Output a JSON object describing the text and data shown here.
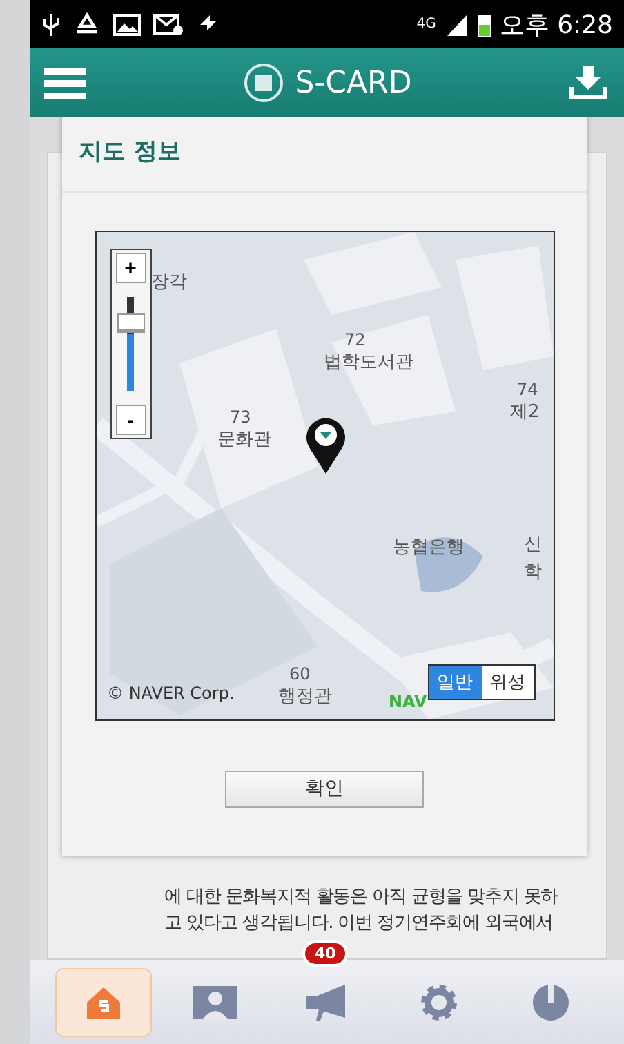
{
  "status_bar": {
    "network": "4G",
    "time": "오후 6:28"
  },
  "app_bar": {
    "title": "S-CARD"
  },
  "background_text": [
    "에 대한 문화복지적 활동은 아직 균형을 맞추지 못하",
    "고 있다고 생각됩니다. 이번 정기연주회에 외국에서"
  ],
  "dialog": {
    "title": "지도 정보",
    "map": {
      "labels": [
        {
          "text": "장각",
          "kind": "name"
        },
        {
          "text": "72",
          "kind": "number"
        },
        {
          "text": "법학도서관",
          "kind": "name"
        },
        {
          "text": "74",
          "kind": "number"
        },
        {
          "text": "제2",
          "kind": "name"
        },
        {
          "text": "73",
          "kind": "number"
        },
        {
          "text": "문화관",
          "kind": "name"
        },
        {
          "text": "농협은행",
          "kind": "name"
        },
        {
          "text": "신",
          "kind": "name"
        },
        {
          "text": "학",
          "kind": "name"
        },
        {
          "text": "60",
          "kind": "number"
        },
        {
          "text": "행정관",
          "kind": "name"
        }
      ],
      "zoom": {
        "plus": "+",
        "minus": "-",
        "level": 0.6
      },
      "copyright": "© NAVER Corp.",
      "logo": "NAV",
      "map_types": [
        {
          "label": "일반",
          "selected": true
        },
        {
          "label": "위성",
          "selected": false
        }
      ]
    },
    "button": "확인"
  },
  "nav": [
    {
      "kind": "home",
      "selected": true
    },
    {
      "kind": "profile",
      "selected": false
    },
    {
      "kind": "megaphone",
      "selected": false,
      "badge": "40"
    },
    {
      "kind": "gear",
      "selected": false
    },
    {
      "kind": "power",
      "selected": false
    }
  ]
}
